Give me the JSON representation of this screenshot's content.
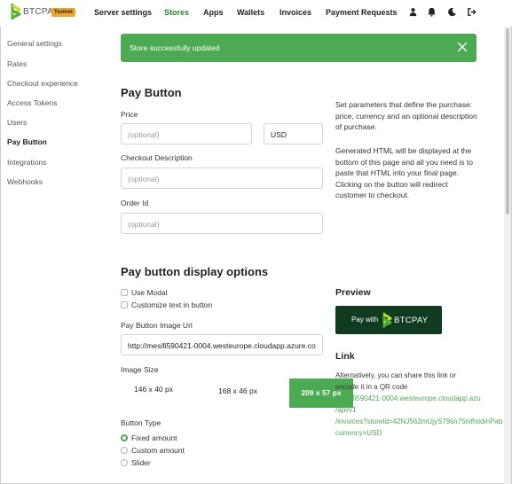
{
  "header": {
    "brand": "BTCPAY",
    "badge": "Testnet",
    "nav": [
      "Server settings",
      "Stores",
      "Apps",
      "Wallets",
      "Invoices",
      "Payment Requests"
    ],
    "icons": [
      "user-icon",
      "bell-icon",
      "moon-icon",
      "logout-icon"
    ]
  },
  "sidebar": {
    "items": [
      "General settings",
      "Rates",
      "Checkout experience",
      "Access Tokens",
      "Users",
      "Pay Button",
      "Integrations",
      "Webhooks"
    ],
    "active": "Pay Button"
  },
  "alert": {
    "text": "Store successfully updated"
  },
  "form": {
    "title": "Pay Button",
    "price_label": "Price",
    "price_placeholder": "(optional)",
    "currency_value": "USD",
    "desc_label": "Checkout Description",
    "desc_placeholder": "(optional)",
    "order_label": "Order Id",
    "order_placeholder": "(optional)"
  },
  "help": {
    "p1": "Set parameters that define the purchase: price, currency and an optional description of purchase.",
    "p2": "Generated HTML will be displayed at the bottom of this page and all you need is to paste that HTML into your final page. Clicking on the button will redirect customer to checkout."
  },
  "display": {
    "title": "Pay button display options",
    "use_modal": "Use Modal",
    "customize_text": "Customize text in button",
    "image_url_label": "Pay Button Image Url",
    "image_url_value": "http://mesifi590421-0004.westeurope.cloudapp.azure.co",
    "image_size_label": "Image Size",
    "sizes": [
      "146 x 40 px",
      "168 x 46 px",
      "209 x 57 px"
    ],
    "selected_size": "209 x 57 px",
    "button_type_label": "Button Type",
    "types": [
      "Fixed amount",
      "Custom amount",
      "Slider"
    ],
    "selected_type": "Fixed amount"
  },
  "preview": {
    "title": "Preview",
    "pay_with": "Pay with",
    "brand": "BTCPAY"
  },
  "link": {
    "title": "Link",
    "lines": [
      "Alternatively, you can share this link or",
      "encode it in a QR code"
    ],
    "url_lines": [
      "/mesifi590421-0004.westeurope.cloudapp.azu",
      "/api/v1",
      "/invoices?storeId=42NJ562mUjyS79sn75nifhiidmPab",
      "currency=USD"
    ]
  },
  "colors": {
    "accent": "#4caa52",
    "dark_button": "#0f3b21",
    "badge": "#f0a82c"
  }
}
